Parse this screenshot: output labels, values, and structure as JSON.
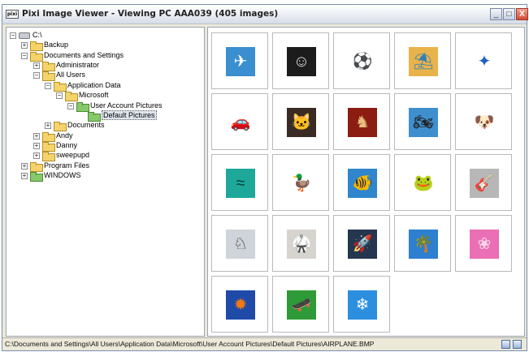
{
  "window": {
    "title": "Pixi Image Viewer - Viewing PC AAA039 (405 images)",
    "app_icon_text": "pixi",
    "buttons": {
      "minimize": "_",
      "maximize": "□",
      "close": "X"
    }
  },
  "tree": {
    "items": [
      {
        "label": "C:\\",
        "expander": "−",
        "icon": "drive-icon"
      },
      {
        "label": "Backup",
        "expander": "+",
        "icon": "folder-icon"
      },
      {
        "label": "Documents and Settings",
        "expander": "−",
        "icon": "folder-icon"
      },
      {
        "label": "Administrator",
        "expander": "+",
        "icon": "folder-icon"
      },
      {
        "label": "All Users",
        "expander": "−",
        "icon": "folder-icon"
      },
      {
        "label": "Application Data",
        "expander": "−",
        "icon": "folder-icon"
      },
      {
        "label": "Microsoft",
        "expander": "−",
        "icon": "folder-icon"
      },
      {
        "label": "User Account Pictures",
        "expander": "−",
        "icon": "folder-icon"
      },
      {
        "label": "Default Pictures",
        "expander": "",
        "icon": "folder-icon",
        "selected": true
      },
      {
        "label": "Documents",
        "expander": "+",
        "icon": "folder-icon"
      },
      {
        "label": "Andy",
        "expander": "+",
        "icon": "folder-icon"
      },
      {
        "label": "Danny",
        "expander": "+",
        "icon": "folder-icon"
      },
      {
        "label": "sweepupd",
        "expander": "+",
        "icon": "folder-icon"
      },
      {
        "label": "Program Files",
        "expander": "+",
        "icon": "folder-icon"
      },
      {
        "label": "WINDOWS",
        "expander": "+",
        "icon": "folder-icon"
      }
    ]
  },
  "thumbnails": [
    {
      "name": "airplane-thumbnail",
      "icon": "airplane-icon",
      "glyph": "✈",
      "bg": "#3a8fd0",
      "fg": "#ffffff"
    },
    {
      "name": "astronaut-thumbnail",
      "icon": "astronaut-icon",
      "glyph": "☺",
      "bg": "#1c1c1c",
      "fg": "#dddddd"
    },
    {
      "name": "soccer-ball-thumbnail",
      "icon": "soccer-ball-icon",
      "glyph": "⚽",
      "bg": "#ffffff",
      "fg": "#111111"
    },
    {
      "name": "beach-thumbnail",
      "icon": "beach-chair-icon",
      "glyph": "⛱",
      "bg": "#e9b34b",
      "fg": "#2f7fb8"
    },
    {
      "name": "butterfly-thumbnail",
      "icon": "butterfly-icon",
      "glyph": "✦",
      "bg": "#ffffff",
      "fg": "#1e62c8"
    },
    {
      "name": "car-thumbnail",
      "icon": "car-icon",
      "glyph": "🚗",
      "bg": "#ffffff",
      "fg": "#c98a1c"
    },
    {
      "name": "cat-thumbnail",
      "icon": "cat-icon",
      "glyph": "🐱",
      "bg": "#3a2c24",
      "fg": "#e0d6c8"
    },
    {
      "name": "chess-thumbnail",
      "icon": "chess-icon",
      "glyph": "♞",
      "bg": "#8c1d12",
      "fg": "#e8c080"
    },
    {
      "name": "dirt-bike-thumbnail",
      "icon": "motorbike-icon",
      "glyph": "🏍",
      "bg": "#3f8fcf",
      "fg": "#222222"
    },
    {
      "name": "dog-thumbnail",
      "icon": "dog-icon",
      "glyph": "🐶",
      "bg": "#ffffff",
      "fg": "#7a4a1e"
    },
    {
      "name": "horses-thumbnail",
      "icon": "horses-icon",
      "glyph": "≈",
      "bg": "#1ea89a",
      "fg": "#0b3b36"
    },
    {
      "name": "duck-thumbnail",
      "icon": "duck-icon",
      "glyph": "🦆",
      "bg": "#ffffff",
      "fg": "#f2c414"
    },
    {
      "name": "fish-thumbnail",
      "icon": "fish-icon",
      "glyph": "🐠",
      "bg": "#2f86cc",
      "fg": "#f08a22"
    },
    {
      "name": "frog-thumbnail",
      "icon": "frog-icon",
      "glyph": "🐸",
      "bg": "#ffffff",
      "fg": "#2fae2a"
    },
    {
      "name": "guitar-thumbnail",
      "icon": "guitar-icon",
      "glyph": "🎸",
      "bg": "#b7b7b7",
      "fg": "#6b3a18"
    },
    {
      "name": "horse-thumbnail",
      "icon": "horse-icon",
      "glyph": "♘",
      "bg": "#cfd4da",
      "fg": "#333333"
    },
    {
      "name": "karate-thumbnail",
      "icon": "karate-icon",
      "glyph": "🥋",
      "bg": "#d7d4d0",
      "fg": "#222222"
    },
    {
      "name": "rocket-launch-thumbnail",
      "icon": "rocket-icon",
      "glyph": "🚀",
      "bg": "#25364f",
      "fg": "#f4c870"
    },
    {
      "name": "palm-trees-thumbnail",
      "icon": "palm-tree-icon",
      "glyph": "🌴",
      "bg": "#2e7fd0",
      "fg": "#1e4f22"
    },
    {
      "name": "pink-flower-thumbnail",
      "icon": "flower-icon",
      "glyph": "❀",
      "bg": "#ea6fb4",
      "fg": "#fbd6ea"
    },
    {
      "name": "orange-flower-thumbnail",
      "icon": "flower-icon",
      "glyph": "✹",
      "bg": "#1f4aa8",
      "fg": "#f07a14"
    },
    {
      "name": "skateboarder-thumbnail",
      "icon": "skateboarder-icon",
      "glyph": "🛹",
      "bg": "#2e9a38",
      "fg": "#6a3a12"
    },
    {
      "name": "snowflake-thumbnail",
      "icon": "snowflake-icon",
      "glyph": "❄",
      "bg": "#2c8ede",
      "fg": "#ffffff"
    }
  ],
  "statusbar": {
    "path": "C:\\Documents and Settings\\All Users\\Application Data\\Microsoft\\User Account Pictures\\Default Pictures\\AIRPLANE.BMP"
  }
}
